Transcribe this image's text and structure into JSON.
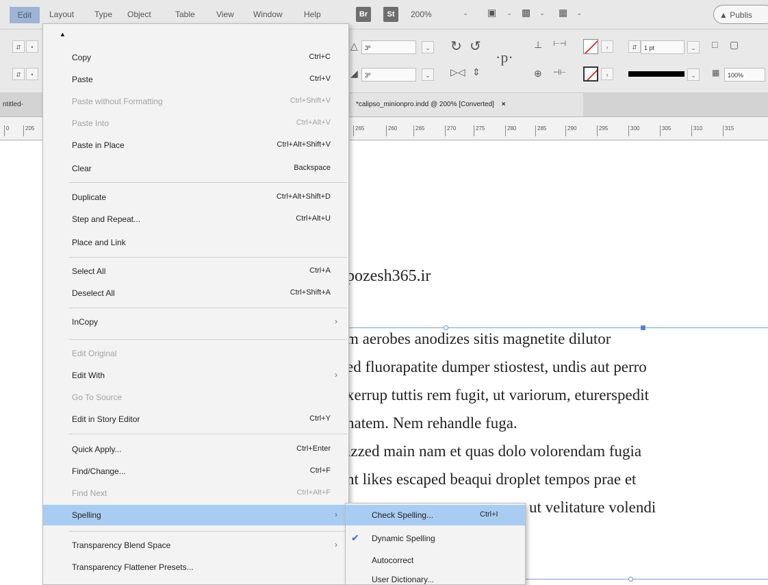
{
  "menubar": {
    "items": [
      "Edit",
      "Layout",
      "Type",
      "Object",
      "Table",
      "View",
      "Window",
      "Help"
    ],
    "br_label": "Br",
    "st_label": "St",
    "zoom": "200%",
    "publish": "Publis"
  },
  "control": {
    "field_a": "3º",
    "field_b": "3º",
    "stroke_weight": "1 pt",
    "percent": "100%"
  },
  "tabs": {
    "left": "ntitled-",
    "doc": "*calipso_minionpro.indd @ 200% [Converted]",
    "close": "×"
  },
  "ruler": [
    "265",
    "260",
    "265",
    "270",
    "275",
    "280",
    "285",
    "290",
    "295",
    "300",
    "305",
    "310",
    "315"
  ],
  "ruler_left": [
    "0",
    "205"
  ],
  "document": {
    "heading": "pozesh365.ir",
    "lines": [
      "m aerobes anodizes sitis magnetite dilutor",
      "ed fluorapatite dumper stiostest, undis aut perro",
      "xerrup tuttis rem fugit, ut variorum, eturerspedit",
      "natem. Nem rehandle fuga.",
      "izzed main nam et quas dolo volorendam fugia",
      "nt likes escaped beaqui droplet tempos prae et",
      "ut velitature volendi"
    ]
  },
  "edit_menu": {
    "items": [
      {
        "label": "Copy",
        "shortcut": "Ctrl+C"
      },
      {
        "label": "Paste",
        "shortcut": "Ctrl+V"
      },
      {
        "label": "Paste without Formatting",
        "shortcut": "Ctrl+Shift+V"
      },
      {
        "label": "Paste Into",
        "shortcut": "Ctrl+Alt+V"
      },
      {
        "label": "Paste in Place",
        "shortcut": "Ctrl+Alt+Shift+V"
      },
      {
        "label": "Clear",
        "shortcut": "Backspace"
      },
      {
        "label": "Duplicate",
        "shortcut": "Ctrl+Alt+Shift+D"
      },
      {
        "label": "Step and Repeat...",
        "shortcut": "Ctrl+Alt+U"
      },
      {
        "label": "Place and Link",
        "shortcut": ""
      },
      {
        "label": "Select All",
        "shortcut": "Ctrl+A"
      },
      {
        "label": "Deselect All",
        "shortcut": "Ctrl+Shift+A"
      },
      {
        "label": "InCopy",
        "shortcut": ""
      },
      {
        "label": "Edit Original",
        "shortcut": ""
      },
      {
        "label": "Edit With",
        "shortcut": ""
      },
      {
        "label": "Go To Source",
        "shortcut": ""
      },
      {
        "label": "Edit in Story Editor",
        "shortcut": "Ctrl+Y"
      },
      {
        "label": "Quick Apply...",
        "shortcut": "Ctrl+Enter"
      },
      {
        "label": "Find/Change...",
        "shortcut": "Ctrl+F"
      },
      {
        "label": "Find Next",
        "shortcut": "Ctrl+Alt+F"
      },
      {
        "label": "Spelling",
        "shortcut": ""
      },
      {
        "label": "Transparency Blend Space",
        "shortcut": ""
      },
      {
        "label": "Transparency Flattener Presets...",
        "shortcut": ""
      }
    ]
  },
  "spelling_submenu": {
    "items": [
      {
        "label": "Check Spelling...",
        "shortcut": "Ctrl+I"
      },
      {
        "label": "Dynamic Spelling",
        "shortcut": ""
      },
      {
        "label": "Autocorrect",
        "shortcut": ""
      },
      {
        "label": "User Dictionary...",
        "shortcut": ""
      }
    ]
  },
  "icons": {
    "checkmark": "✔",
    "submenu_arrow": "›",
    "caret": "▲",
    "chevron": "⌄"
  },
  "colors": {
    "highlight": "#a9cdf2",
    "menu_bg": "#f3f3f3",
    "frame": "#7aa0e0"
  }
}
